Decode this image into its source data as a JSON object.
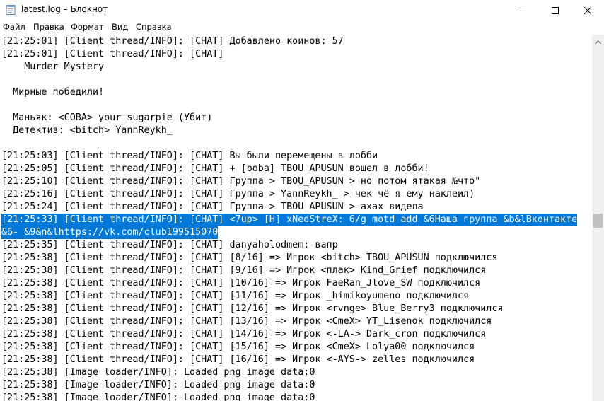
{
  "window": {
    "title": "latest.log – Блокнот",
    "icon": "notepad-icon",
    "controls": [
      "minimize-icon",
      "maximize-icon",
      "close-icon"
    ]
  },
  "menu": {
    "items": [
      "Файл",
      "Правка",
      "Формат",
      "Вид",
      "Справка"
    ]
  },
  "editor": {
    "selection_color": "#0078d7",
    "lines": [
      "[21:25:01] [Client thread/INFO]: [CHAT] Добавлено коинов: 57",
      "[21:25:01] [Client thread/INFO]: [CHAT]",
      "    Murder Mystery",
      "",
      "  Мирные победили!",
      "",
      "  Маньяк: <COBA> your_sugarpie (Убит)",
      "  Детектив: <bitch> YannReykh_",
      "",
      "[21:25:03] [Client thread/INFO]: [CHAT] Вы были перемещены в лобби",
      "[21:25:05] [Client thread/INFO]: [CHAT] + [boba] TBOU_APUSUN вошел в лобби!",
      "[21:25:10] [Client thread/INFO]: [CHAT] Группа > TBOU_APUSUN > но потом ятакая №что\"",
      "[21:25:16] [Client thread/INFO]: [CHAT] Группа > YannReykh_ > чек чё я ему наклеил)",
      "[21:25:24] [Client thread/INFO]: [CHAT] Группа > TBOU_APUSUN > ахах видела",
      "[21:25:33] [Client thread/INFO]: [CHAT] <7up> [H] xNedStreX: 6/g motd add &6Наша группа &b&lВконтакте",
      "&6- &9&n&lhttps://vk.com/club199515070",
      "[21:25:35] [Client thread/INFO]: [CHAT] danyaholodmem: вапр",
      "[21:25:38] [Client thread/INFO]: [CHAT] [8/16] => Игрок <bitch> TBOU_APUSUN подключился",
      "[21:25:38] [Client thread/INFO]: [CHAT] [9/16] => Игрок <плак> Kind_Grief подключился",
      "[21:25:38] [Client thread/INFO]: [CHAT] [10/16] => Игрок FaeRan_Jlove_SW подключился",
      "[21:25:38] [Client thread/INFO]: [CHAT] [11/16] => Игрок _himikoyumeno подключился",
      "[21:25:38] [Client thread/INFO]: [CHAT] [12/16] => Игрок <rvnge> Blue_Berry3 подключился",
      "[21:25:38] [Client thread/INFO]: [CHAT] [13/16] => Игрок <CmeX> YT_Lisenok подключился",
      "[21:25:38] [Client thread/INFO]: [CHAT] [14/16] => Игрок <-LA-> Dark_cron подключился",
      "[21:25:38] [Client thread/INFO]: [CHAT] [15/16] => Игрок <CmeX> Lolya00 подключился",
      "[21:25:38] [Client thread/INFO]: [CHAT] [16/16] => Игрок <-AYS-> zelles подключился",
      "[21:25:38] [Image loader/INFO]: Loaded png image data:0",
      "[21:25:38] [Image loader/INFO]: Loaded png image data:0",
      "[21:25:38] [Image loader/INFO]: Loaded png image data:0"
    ],
    "selected_lines": [
      14,
      15
    ]
  },
  "scrollbar": {
    "up_icon": "scroll-up-arrow-icon"
  }
}
